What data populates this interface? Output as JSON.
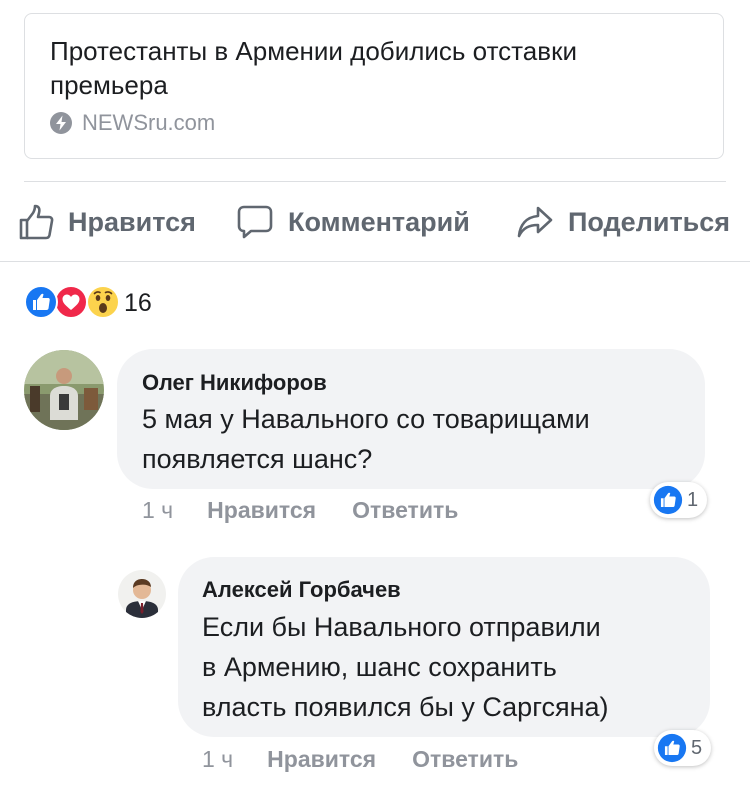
{
  "link": {
    "title": "Протестанты в Армении добились отставки премьера",
    "source": "NEWSru.com"
  },
  "actions": {
    "like": "Нравится",
    "comment": "Комментарий",
    "share": "Поделиться"
  },
  "reactions": {
    "types": [
      "like-icon",
      "love-icon",
      "wow-icon"
    ],
    "count": "16"
  },
  "comments": [
    {
      "author": "Олег Никифоров",
      "lines": [
        "5 мая у Навального со товарищами",
        "появляется шанс?"
      ],
      "time": "1 ч",
      "like": "Нравится",
      "reply": "Ответить",
      "likes": "1"
    },
    {
      "author": "Алексей Горбачев",
      "lines": [
        "Если бы Навального отправили",
        "в Армению, шанс сохранить",
        "власть появился бы у Саргсяна)"
      ],
      "time": "1 ч",
      "like": "Нравится",
      "reply": "Ответить",
      "likes": "5"
    }
  ],
  "colors": {
    "like_blue": "#1877f2",
    "love_red": "#f0284a",
    "wow_yellow": "#fcd34d",
    "muted": "#90949c",
    "action": "#606770"
  }
}
